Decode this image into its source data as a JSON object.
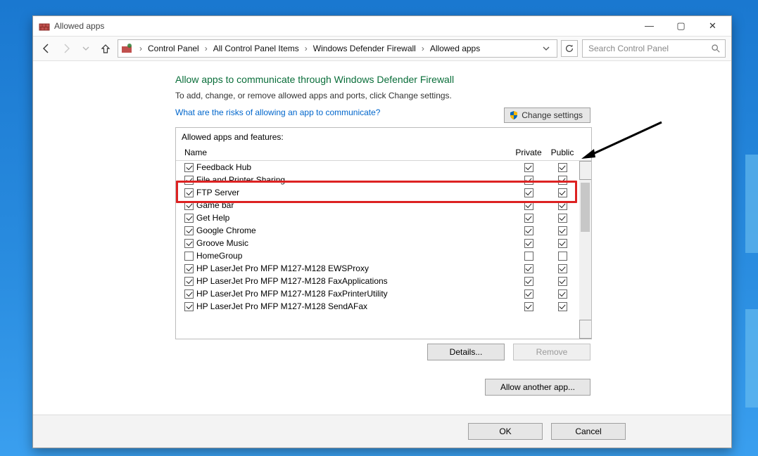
{
  "window": {
    "title": "Allowed apps"
  },
  "breadcrumb": {
    "items": [
      "Control Panel",
      "All Control Panel Items",
      "Windows Defender Firewall",
      "Allowed apps"
    ]
  },
  "search": {
    "placeholder": "Search Control Panel"
  },
  "page": {
    "title": "Allow apps to communicate through Windows Defender Firewall",
    "subtitle": "To add, change, or remove allowed apps and ports, click Change settings.",
    "risk_link": "What are the risks of allowing an app to communicate?",
    "change_settings": "Change settings"
  },
  "panel": {
    "title": "Allowed apps and features:",
    "columns": {
      "name": "Name",
      "private": "Private",
      "public": "Public"
    },
    "rows": [
      {
        "name": "Feedback Hub",
        "enabled": true,
        "private": true,
        "public": true
      },
      {
        "name": "File and Printer Sharing",
        "enabled": true,
        "private": true,
        "public": true
      },
      {
        "name": "FTP Server",
        "enabled": true,
        "private": true,
        "public": true
      },
      {
        "name": "Game bar",
        "enabled": true,
        "private": true,
        "public": true
      },
      {
        "name": "Get Help",
        "enabled": true,
        "private": true,
        "public": true
      },
      {
        "name": "Google Chrome",
        "enabled": true,
        "private": true,
        "public": true
      },
      {
        "name": "Groove Music",
        "enabled": true,
        "private": true,
        "public": true
      },
      {
        "name": "HomeGroup",
        "enabled": false,
        "private": false,
        "public": false
      },
      {
        "name": "HP LaserJet Pro MFP M127-M128 EWSProxy",
        "enabled": true,
        "private": true,
        "public": true
      },
      {
        "name": "HP LaserJet Pro MFP M127-M128 FaxApplications",
        "enabled": true,
        "private": true,
        "public": true
      },
      {
        "name": "HP LaserJet Pro MFP M127-M128 FaxPrinterUtility",
        "enabled": true,
        "private": true,
        "public": true
      },
      {
        "name": "HP LaserJet Pro MFP M127-M128 SendAFax",
        "enabled": true,
        "private": true,
        "public": true
      }
    ]
  },
  "buttons": {
    "details": "Details...",
    "remove": "Remove",
    "allow_another": "Allow another app...",
    "ok": "OK",
    "cancel": "Cancel"
  },
  "highlight_row_index": 2
}
